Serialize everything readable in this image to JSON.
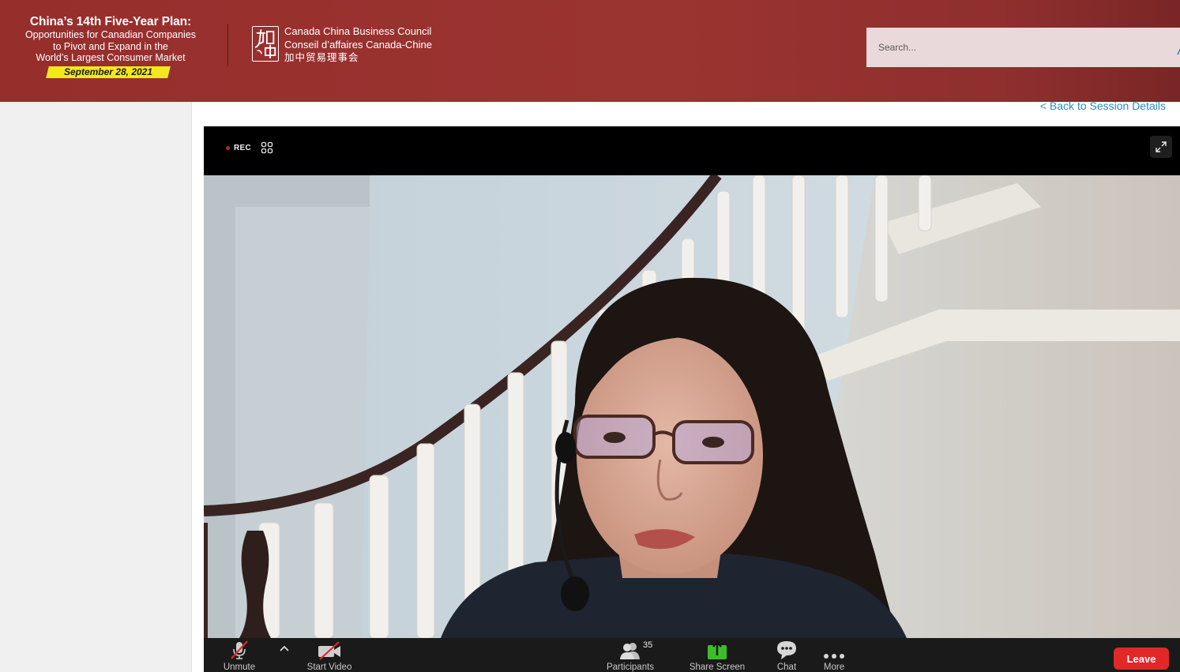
{
  "header": {
    "event_title": "China’s 14th Five-Year Plan:",
    "event_subtitle_lines": [
      "Opportunities for Canadian Companies",
      "to Pivot and Expand in the",
      "World’s Largest Consumer Market"
    ],
    "event_date": "September 28, 2021",
    "org_name_en": "Canada China Business Council",
    "org_name_fr": "Conseil d’affaires Canada-Chine",
    "org_name_cn": "加中贸易理事会",
    "search_placeholder": "Search..."
  },
  "back_link": "< Back to Session Details",
  "meeting": {
    "rec_label": "REC",
    "toolbar": {
      "unmute_label": "Unmute",
      "start_video_label": "Start Video",
      "participants_label": "Participants",
      "participants_count": "35",
      "share_screen_label": "Share Screen",
      "chat_label": "Chat",
      "more_label": "More",
      "leave_label": "Leave"
    }
  },
  "colors": {
    "header_bg": "#962e2c",
    "date_highlight": "#f3e81c",
    "link": "#2f8ac2",
    "leave": "#e02828",
    "share_green": "#3dbe28"
  }
}
